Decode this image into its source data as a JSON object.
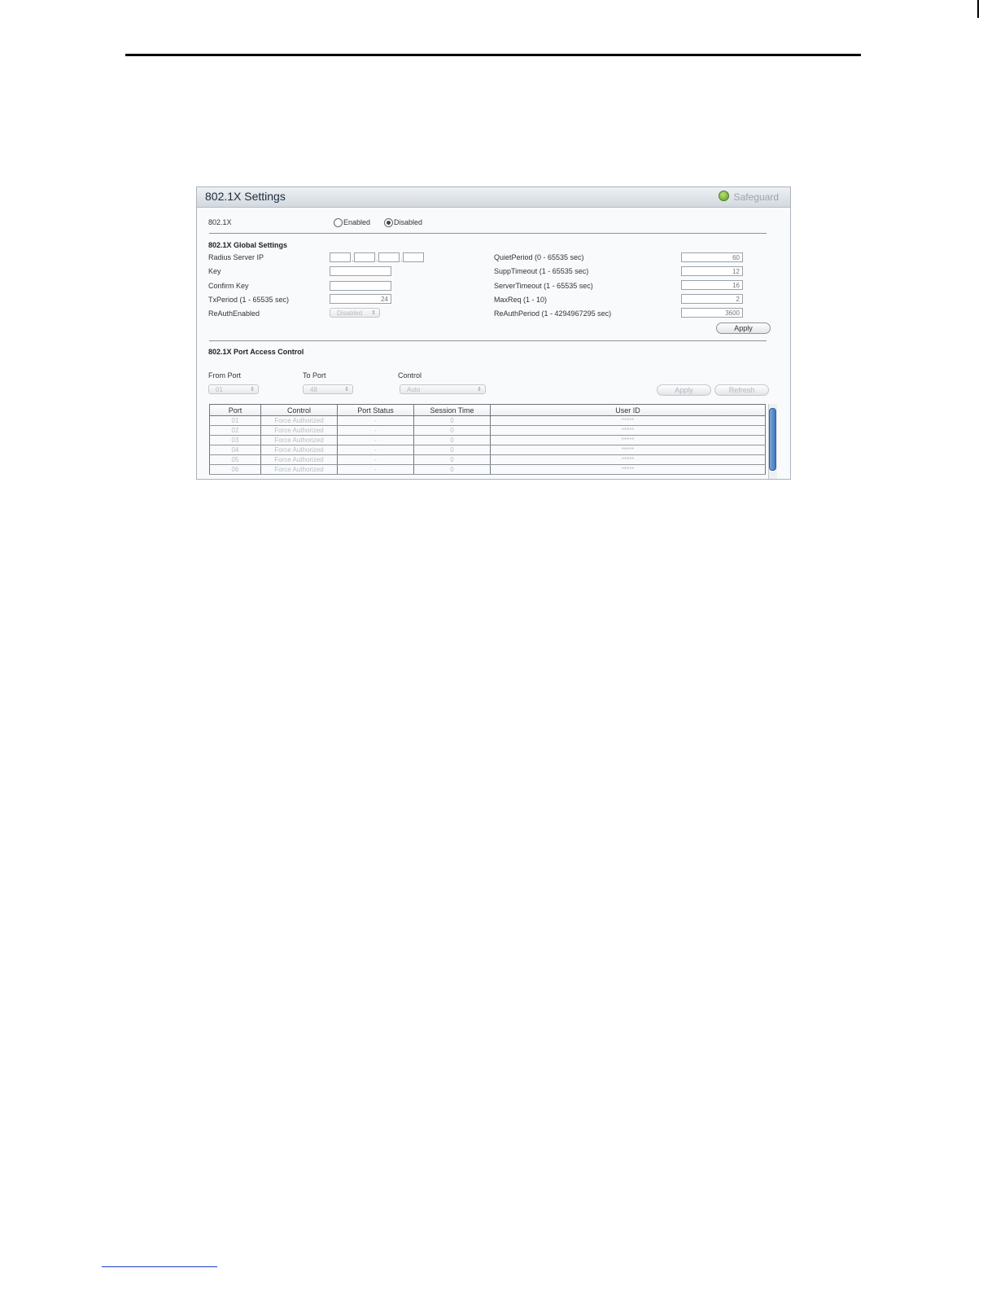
{
  "panel": {
    "title": "802.1X Settings",
    "safeguard": "Safeguard",
    "safeguard_icon": "safeguard-status-icon"
  },
  "dot1x": {
    "label": "802.1X",
    "enabled_label": "Enabled",
    "disabled_label": "Disabled",
    "selected": "Disabled"
  },
  "global": {
    "section_title": "802.1X Global Settings",
    "radius_ip_label": "Radius Server IP",
    "radius_ip": [
      "",
      "",
      "",
      ""
    ],
    "key_label": "Key",
    "key_value": "",
    "confirm_key_label": "Confirm Key",
    "confirm_key_value": "",
    "txperiod_label": "TxPeriod (1 - 65535 sec)",
    "txperiod_value": "24",
    "reauth_enabled_label": "ReAuthEnabled",
    "reauth_enabled_value": "Disabled",
    "quiet_label": "QuietPeriod (0 - 65535 sec)",
    "quiet_value": "60",
    "supp_label": "SuppTimeout (1 - 65535 sec)",
    "supp_value": "12",
    "server_label": "ServerTimeout (1 - 65535 sec)",
    "server_value": "16",
    "maxreq_label": "MaxReq (1 - 10)",
    "maxreq_value": "2",
    "reauth_period_label": "ReAuthPeriod (1 - 4294967295 sec)",
    "reauth_period_value": "3600",
    "apply_label": "Apply"
  },
  "pac": {
    "section_title": "802.1X Port Access Control",
    "from_port_label": "From Port",
    "from_port_value": "01",
    "to_port_label": "To Port",
    "to_port_value": "48",
    "control_label": "Control",
    "control_value": "Auto",
    "apply_label": "Apply",
    "refresh_label": "Refresh"
  },
  "table": {
    "headers": [
      "Port",
      "Control",
      "Port Status",
      "Session Time",
      "User ID"
    ],
    "rows": [
      [
        "01",
        "Force Authorized",
        "-",
        "0",
        "*****"
      ],
      [
        "02",
        "Force Authorized",
        "-",
        "0",
        "*****"
      ],
      [
        "03",
        "Force Authorized",
        "-",
        "0",
        "*****"
      ],
      [
        "04",
        "Force Authorized",
        "-",
        "0",
        "*****"
      ],
      [
        "05",
        "Force Authorized",
        "-",
        "0",
        "*****"
      ],
      [
        "06",
        "Force Authorized",
        "-",
        "0",
        "*****"
      ]
    ]
  },
  "colors": {
    "rule": "#000000",
    "footer_link": "#1a3cc8",
    "safeguard_green": "#5b9a1e",
    "scrollbar": "#3f76c0"
  }
}
